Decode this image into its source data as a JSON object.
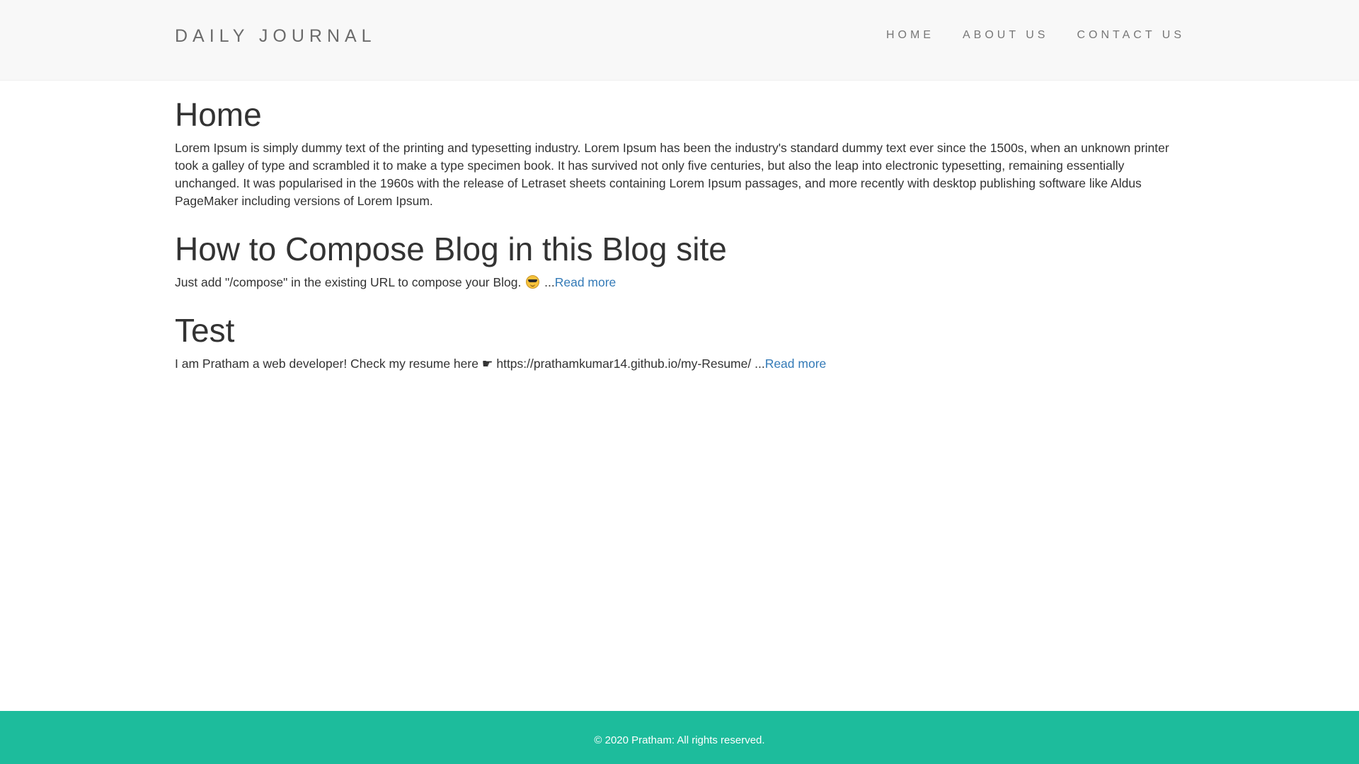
{
  "navbar": {
    "brand": "DAILY JOURNAL",
    "links": [
      {
        "label": "HOME"
      },
      {
        "label": "ABOUT US"
      },
      {
        "label": "CONTACT US"
      }
    ]
  },
  "home": {
    "heading": "Home",
    "text": "Lorem Ipsum is simply dummy text of the printing and typesetting industry. Lorem Ipsum has been the industry's standard dummy text ever since the 1500s, when an unknown printer took a galley of type and scrambled it to make a type specimen book. It has survived not only five centuries, but also the leap into electronic typesetting, remaining essentially unchanged. It was popularised in the 1960s with the release of Letraset sheets containing Lorem Ipsum passages, and more recently with desktop publishing software like Aldus PageMaker including versions of Lorem Ipsum."
  },
  "posts": [
    {
      "title": "How to Compose Blog in this Blog site",
      "excerpt": "Just add \"/compose\" in the existing URL to compose your Blog.",
      "emoji_icon": "smiling-face-with-sunglasses-icon",
      "ellipsis": " ...",
      "read_more": "Read more"
    },
    {
      "title": "Test",
      "excerpt": "I am Pratham a web developer! Check my resume here ☛ https://prathamkumar14.github.io/my-Resume/",
      "ellipsis": " ...",
      "read_more": "Read more"
    }
  ],
  "footer": {
    "text": "© 2020 Pratham: All rights reserved."
  },
  "colors": {
    "navbar_bg": "#f8f8f8",
    "link": "#337ab7",
    "footer_bg": "#1dbc9c",
    "text": "#333333"
  }
}
